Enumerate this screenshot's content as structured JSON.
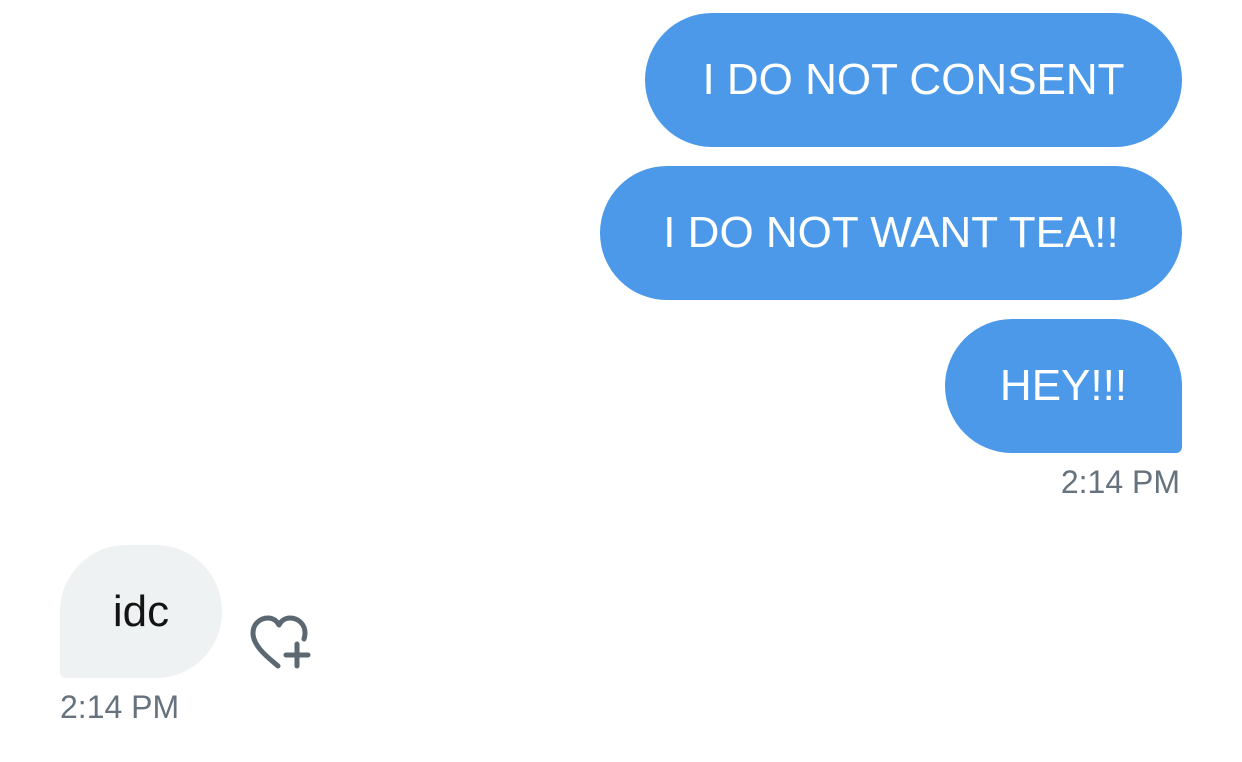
{
  "messages": [
    {
      "id": "b1",
      "direction": "sent",
      "text": "I DO NOT CONSENT"
    },
    {
      "id": "b2",
      "direction": "sent",
      "text": "I DO NOT WANT TEA!!"
    },
    {
      "id": "b3",
      "direction": "sent",
      "text": "HEY!!!"
    },
    {
      "id": "b4",
      "direction": "received",
      "text": "idc"
    }
  ],
  "timestamps": {
    "sent": "2:14 PM",
    "received": "2:14 PM"
  },
  "icons": {
    "like": "heart-plus-icon"
  },
  "colors": {
    "sent_bubble": "#4c99e9",
    "received_bubble": "#eff2f3",
    "timestamp": "#66727d",
    "icon": "#5b6872"
  }
}
